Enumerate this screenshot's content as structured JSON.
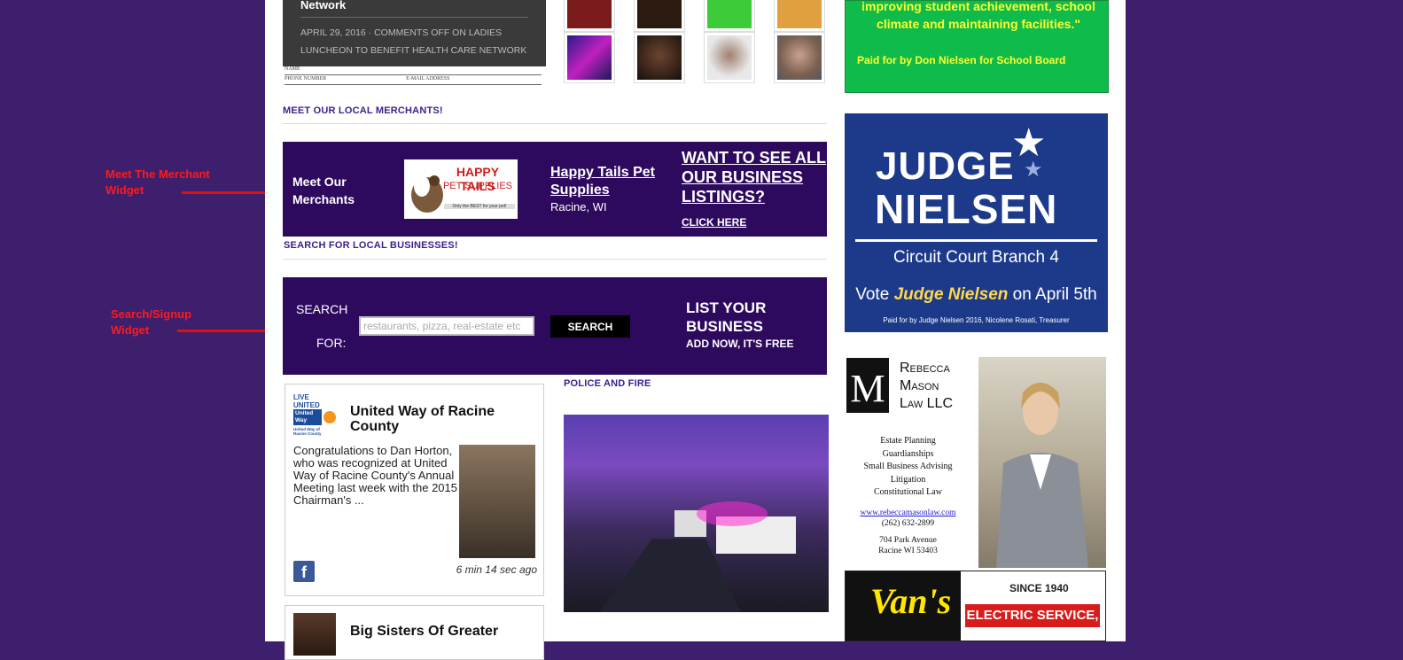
{
  "annotations": {
    "merchant_widget": "Meet The Merchant Widget",
    "search_widget": "Search/Signup Widget"
  },
  "post": {
    "title": "Network",
    "meta": "APRIL 29, 2016 · COMMENTS OFF ON LADIES LUNCHEON TO BENEFIT HEALTH CARE NETWORK",
    "form_name": "NAME",
    "form_phone": "PHONE NUMBER",
    "form_email": "E-MAIL ADDRESS"
  },
  "sections": {
    "merchants": "MEET OUR LOCAL MERCHANTS!",
    "search": "SEARCH FOR LOCAL BUSINESSES!",
    "police": "POLICE AND FIRE"
  },
  "merchant_widget": {
    "label": "Meet Our Merchants",
    "logo_title": "HAPPY TAILS",
    "logo_sub": "PET SUPPLIES",
    "logo_tag": "Only the BEST for your pet!",
    "merchant_name": "Happy Tails Pet Supplies",
    "merchant_city": "Racine, WI",
    "cta": "WANT TO SEE ALL OUR BUSINESS LISTINGS?",
    "click": "CLICK HERE"
  },
  "search_widget": {
    "label_top": "SEARCH",
    "label_bottom": "FOR:",
    "placeholder": "restaurants, pizza, real-estate etc",
    "button": "SEARCH",
    "list_title": "LIST YOUR BUSINESS",
    "list_sub": "ADD NOW, IT'S FREE"
  },
  "feed_card": {
    "logo_top": "LIVE UNITED",
    "logo_name": "United Way",
    "logo_sub": "United Way of Racine County",
    "title": "United Way of Racine County",
    "body": "Congratulations to Dan Horton, who was recognized at United Way of Racine County's Annual Meeting last week with the 2015 Chairman's ...",
    "time": "6 min 14 sec ago",
    "fb": "f"
  },
  "feed_card2": {
    "title": "Big Sisters Of Greater"
  },
  "ads": {
    "green_quote": "improving student achievement, school climate and maintaining facilities.\"",
    "green_paid": "Paid for by Don Nielsen for School Board",
    "judge_line1": "JUDGE",
    "judge_line2": "NIELSEN",
    "judge_court": "Circuit Court Branch 4",
    "judge_vote_pre": "Vote",
    "judge_vote_name": "Judge Nielsen",
    "judge_vote_post": "on April 5th",
    "judge_paid": "Paid for by Judge Nielsen 2016, Nicolene Rosati, Treasurer",
    "rebecca_m": "M",
    "rebecca_name1": "Rebecca",
    "rebecca_name2": "Mason",
    "rebecca_name3": "Law LLC",
    "rebecca_services": [
      "Estate Planning",
      "Guardianships",
      "Small Business Advising",
      "Litigation",
      "Constitutional Law"
    ],
    "rebecca_url": "www.rebeccamasonlaw.com",
    "rebecca_phone": "(262) 632-2899",
    "rebecca_addr1": "704 Park Avenue",
    "rebecca_addr2": "Racine WI 53403",
    "vans_logo": "Van's",
    "vans_since": "SINCE 1940",
    "vans_name": "ELECTRIC SERVICE, INC."
  },
  "colors": {
    "background": "#3d1f6e",
    "widget": "#2e0a5e",
    "section_title": "#3d1f8c",
    "annotation": "#ff1a1a",
    "green_ad": "#0fbb4a",
    "judge_ad": "#1d3a8a"
  }
}
